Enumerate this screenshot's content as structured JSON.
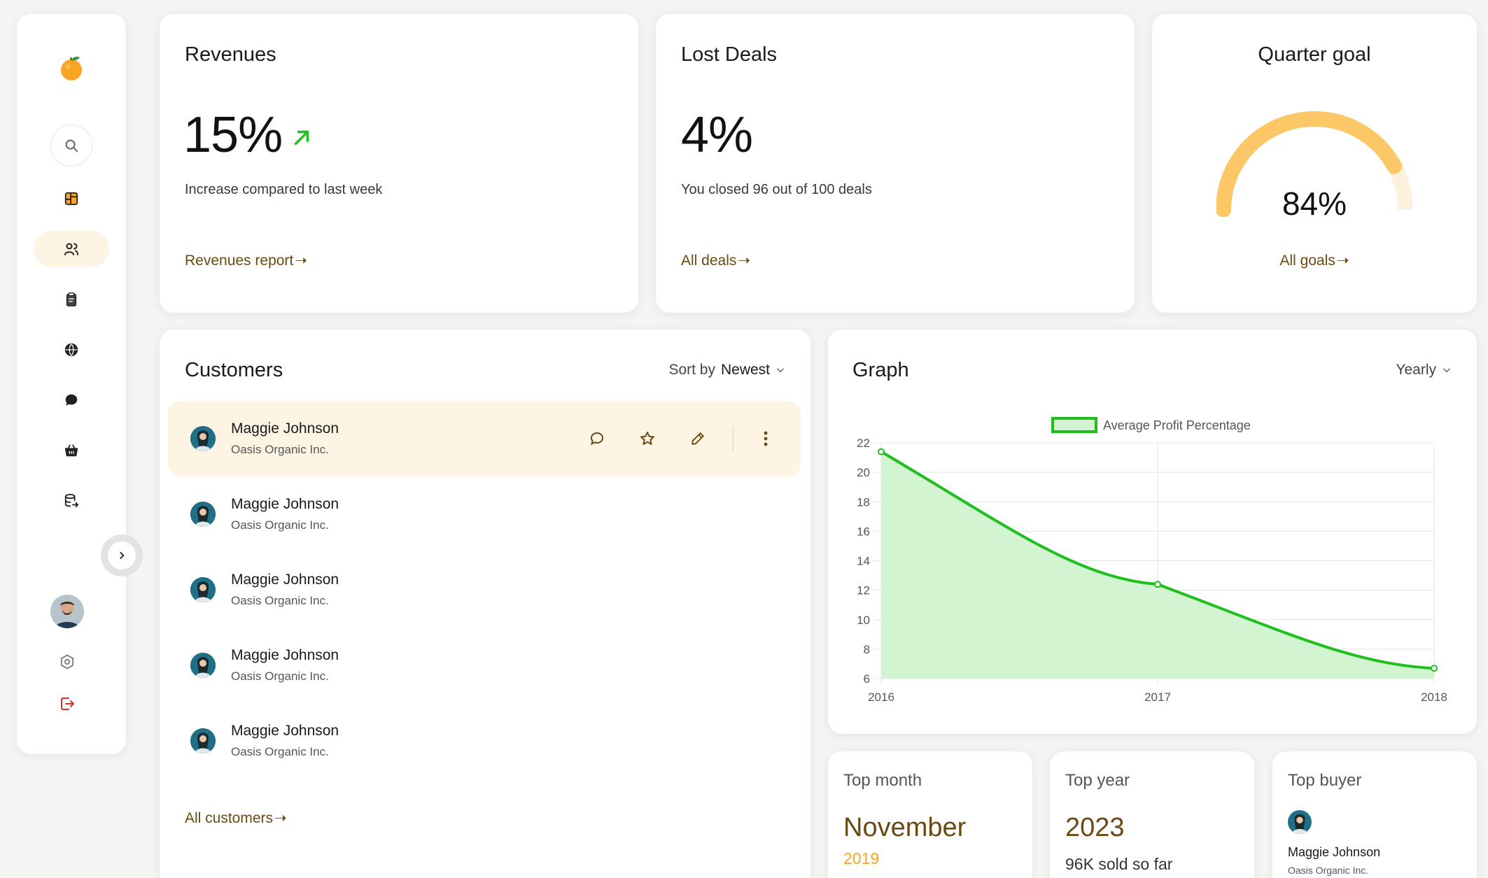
{
  "colors": {
    "accent": "#f6a623",
    "link": "#6b4a12",
    "gauge": "#fcc867",
    "gauge_track": "#fdf1dd",
    "chart_line": "#1fbf1f",
    "chart_fill": "#d3f4d0",
    "logout": "#d9302c",
    "increase_arrow": "#22c322"
  },
  "sidebar": {
    "items": [
      {
        "icon": "dashboard-icon"
      },
      {
        "icon": "users-icon",
        "active": true
      },
      {
        "icon": "clipboard-icon"
      },
      {
        "icon": "globe-icon"
      },
      {
        "icon": "chat-icon"
      },
      {
        "icon": "basket-icon"
      },
      {
        "icon": "database-export-icon"
      }
    ],
    "bottom": [
      {
        "icon": "settings-icon"
      },
      {
        "icon": "logout-icon"
      }
    ]
  },
  "revenues": {
    "title": "Revenues",
    "value": "15%",
    "description": "Increase compared to last week",
    "link": "Revenues report"
  },
  "lost_deals": {
    "title": "Lost Deals",
    "value": "4%",
    "description": "You closed 96 out of 100 deals",
    "link": "All deals"
  },
  "quarter_goal": {
    "title": "Quarter goal",
    "value": "84%",
    "progress": 0.84,
    "link": "All goals"
  },
  "customers": {
    "title": "Customers",
    "sort_label": "Sort by",
    "sort_value": "Newest",
    "rows": [
      {
        "name": "Maggie Johnson",
        "company": "Oasis Organic Inc.",
        "highlighted": true
      },
      {
        "name": "Maggie Johnson",
        "company": "Oasis Organic Inc."
      },
      {
        "name": "Maggie Johnson",
        "company": "Oasis Organic Inc."
      },
      {
        "name": "Maggie Johnson",
        "company": "Oasis Organic Inc."
      },
      {
        "name": "Maggie Johnson",
        "company": "Oasis Organic Inc."
      }
    ],
    "link": "All customers"
  },
  "graph": {
    "title": "Graph",
    "period": "Yearly"
  },
  "chart_data": {
    "type": "area",
    "x": [
      "2016",
      "2017",
      "2018"
    ],
    "series": [
      {
        "name": "Average Profit Percentage",
        "values": [
          21.4,
          12.4,
          6.7
        ]
      }
    ],
    "ylim": [
      6,
      22
    ],
    "yticks": [
      6,
      8,
      10,
      12,
      14,
      16,
      18,
      20,
      22
    ],
    "grid": true,
    "legend": "top"
  },
  "top_month": {
    "title": "Top month",
    "value": "November",
    "sub": "2019"
  },
  "top_year": {
    "title": "Top year",
    "value": "2023",
    "sub": "96K sold so far"
  },
  "top_buyer": {
    "title": "Top buyer",
    "name": "Maggie Johnson",
    "company": "Oasis Organic Inc."
  }
}
